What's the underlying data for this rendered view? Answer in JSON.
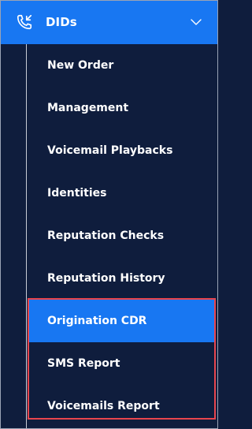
{
  "header": {
    "title": "DIDs",
    "icon": "phone-incoming-icon",
    "expand_icon": "chevron-down-icon",
    "background": "#1877f2"
  },
  "submenu": {
    "items": [
      {
        "label": "New Order",
        "active": false
      },
      {
        "label": "Management",
        "active": false
      },
      {
        "label": "Voicemail Playbacks",
        "active": false
      },
      {
        "label": "Identities",
        "active": false
      },
      {
        "label": "Reputation Checks",
        "active": false
      },
      {
        "label": "Reputation History",
        "active": false
      },
      {
        "label": "Origination CDR",
        "active": true
      },
      {
        "label": "SMS Report",
        "active": false
      },
      {
        "label": "Voicemails Report",
        "active": false
      }
    ]
  },
  "colors": {
    "sidebar_bg": "#0f1d3d",
    "active_bg": "#1877f2",
    "highlight_border": "#e8454d"
  }
}
